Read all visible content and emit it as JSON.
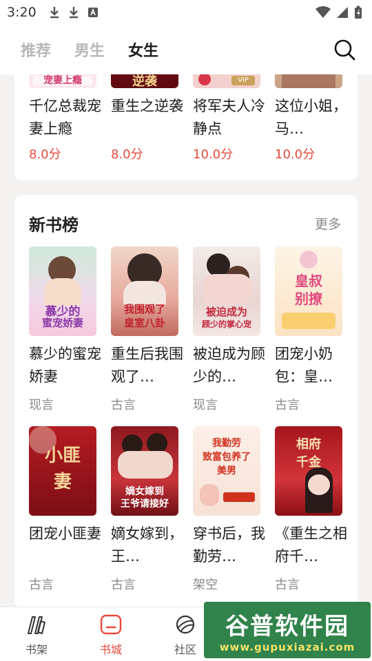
{
  "status_bar": {
    "time": "3:20"
  },
  "header": {
    "tabs": [
      {
        "label": "推荐",
        "active": false
      },
      {
        "label": "男生",
        "active": false
      },
      {
        "label": "女生",
        "active": true
      }
    ]
  },
  "top_section": {
    "books": [
      {
        "title": "千亿总裁宠妻上瘾",
        "score": "8.0分"
      },
      {
        "title": "重生之逆袭",
        "score": "8.0分"
      },
      {
        "title": "将军夫人冷静点",
        "score": "10.0分"
      },
      {
        "title": "这位小姐，马…",
        "score": "10.0分"
      }
    ]
  },
  "new_books": {
    "title": "新书榜",
    "more": "更多",
    "books": [
      {
        "title": "慕少的蜜宠娇妻",
        "genre": "现言"
      },
      {
        "title": "重生后我围观了…",
        "genre": "古言"
      },
      {
        "title": "被迫成为顾少的…",
        "genre": "现言"
      },
      {
        "title": "团宠小奶包：皇…",
        "genre": "古言"
      },
      {
        "title": "团宠小匪妻",
        "genre": "古言"
      },
      {
        "title": "嫡女嫁到，王…",
        "genre": "古言"
      },
      {
        "title": "穿书后，我勤劳…",
        "genre": "架空"
      },
      {
        "title": "《重生之相府千…",
        "genre": "古言"
      }
    ]
  },
  "bottom_nav": {
    "items": [
      {
        "label": "书架"
      },
      {
        "label": "书城"
      },
      {
        "label": "社区"
      }
    ]
  },
  "watermark": {
    "main": "谷普软件园",
    "sub": "www.gupuxiazai.com"
  },
  "colors": {
    "accent": "#e84a3c",
    "active_tab": "#1a1a1a",
    "inactive_tab": "#b8b8b8"
  }
}
